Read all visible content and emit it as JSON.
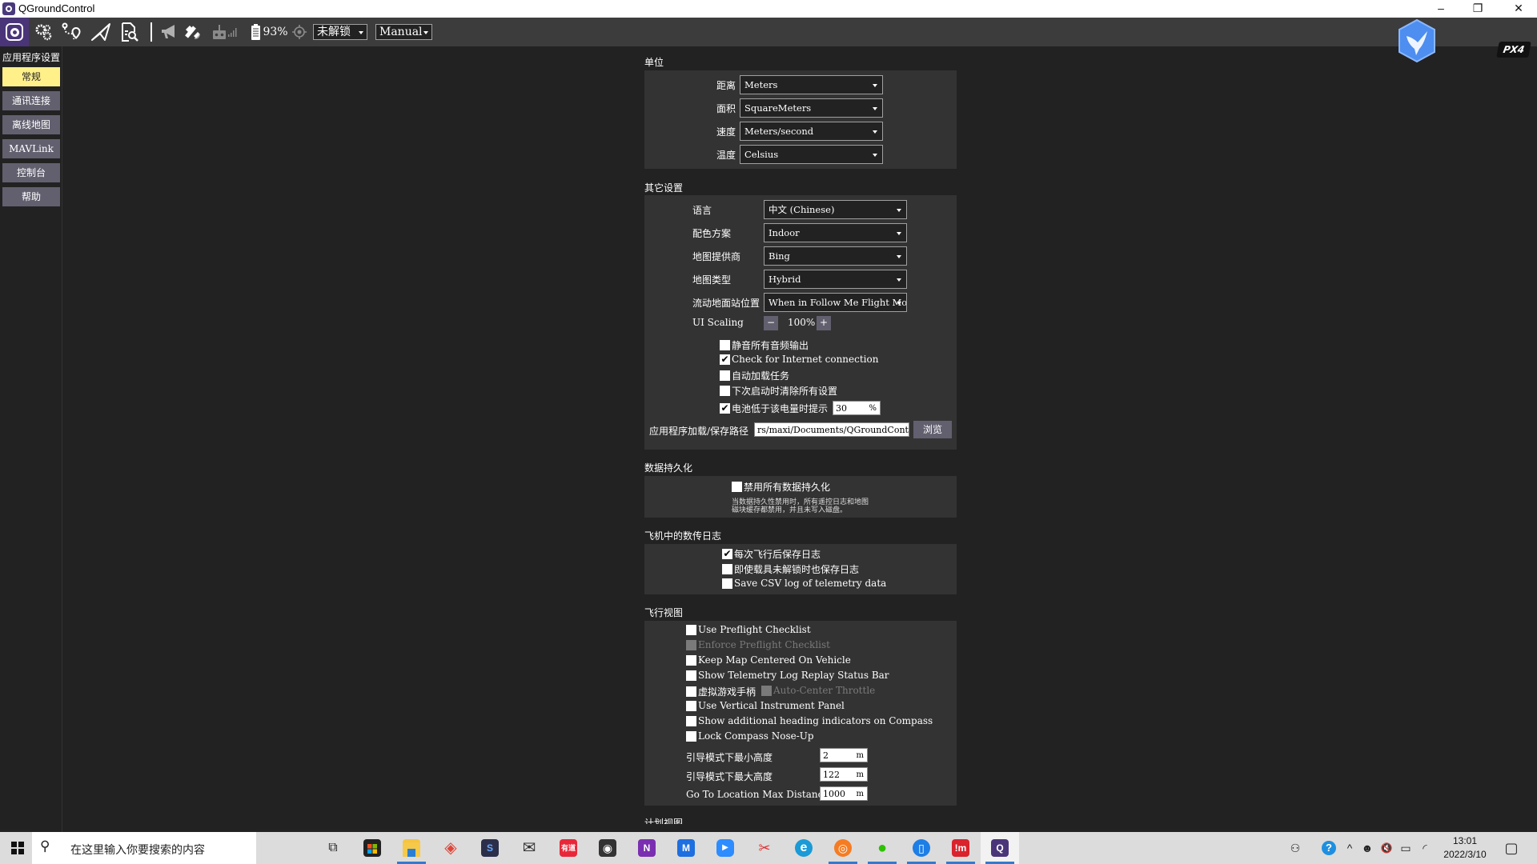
{
  "window": {
    "title": "QGroundControl",
    "controls": {
      "minimize": "–",
      "restore": "❐",
      "close": "✕"
    }
  },
  "toolbar": {
    "icons": [
      "qgc-logo-icon",
      "settings-gears-icon",
      "plan-route-icon",
      "fly-paper-plane-icon",
      "analyze-document-icon",
      "messages-megaphone-icon",
      "gps-satellite-icon",
      "rc-transmitter-icon",
      "rc-signal-icon",
      "battery-icon",
      "mode-target-icon"
    ],
    "battery_label": "93%",
    "arm_status": "未解锁",
    "flight_mode": "Manual",
    "brand_badge": "bird-hexagon-icon",
    "px4_logo": "PX4"
  },
  "sidebar": {
    "header": "应用程序设置",
    "items": [
      {
        "label": "常规",
        "active": true
      },
      {
        "label": "通讯连接",
        "active": false
      },
      {
        "label": "离线地图",
        "active": false
      },
      {
        "label": "MAVLink",
        "active": false
      },
      {
        "label": "控制台",
        "active": false
      },
      {
        "label": "帮助",
        "active": false
      }
    ]
  },
  "units": {
    "title": "单位",
    "rows": [
      {
        "label": "距离",
        "value": "Meters"
      },
      {
        "label": "面积",
        "value": "SquareMeters"
      },
      {
        "label": "速度",
        "value": "Meters/second"
      },
      {
        "label": "温度",
        "value": "Celsius"
      }
    ]
  },
  "misc": {
    "title": "其它设置",
    "rows": [
      {
        "label": "语言",
        "value": "中文 (Chinese)"
      },
      {
        "label": "配色方案",
        "value": "Indoor"
      },
      {
        "label": "地图提供商",
        "value": "Bing"
      },
      {
        "label": "地图类型",
        "value": "Hybrid"
      },
      {
        "label": "流动地面站位置",
        "value": "When in Follow Me Flight Mode"
      }
    ],
    "ui_scaling": {
      "label": "UI Scaling",
      "minus": "−",
      "value": "100%",
      "plus": "+"
    },
    "checks": [
      {
        "label": "静音所有音频输出",
        "checked": false
      },
      {
        "label": "Check for Internet connection",
        "checked": true
      },
      {
        "label": "自动加载任务",
        "checked": false
      },
      {
        "label": "下次启动时清除所有设置",
        "checked": false
      },
      {
        "label": "电池低于该电量时提示",
        "checked": true
      }
    ],
    "battery_threshold": {
      "value": "30",
      "unit": "%"
    },
    "save_path": {
      "label": "应用程序加载/保存路径",
      "value": "rs/maxi/Documents/QGroundControl",
      "browse": "浏览"
    }
  },
  "persistence": {
    "title": "数据持久化",
    "check": {
      "label": "禁用所有数据持久化",
      "checked": false
    },
    "note_line1": "当数据持久性禁用时，所有遥控日志和地图",
    "note_line2": "磁块缓存都禁用，并且未写入磁盘。"
  },
  "telemetry_log": {
    "title": "飞机中的数传日志",
    "checks": [
      {
        "label": "每次飞行后保存日志",
        "checked": true
      },
      {
        "label": "即使载具未解锁时也保存日志",
        "checked": false
      },
      {
        "label": "Save CSV log of telemetry data",
        "checked": false
      }
    ]
  },
  "fly_view": {
    "title": "飞行视图",
    "checks": [
      {
        "label": "Use Preflight Checklist",
        "checked": false,
        "disabled": false
      },
      {
        "label": "Enforce Preflight Checklist",
        "checked": false,
        "disabled": true
      },
      {
        "label": "Keep Map Centered On Vehicle",
        "checked": false,
        "disabled": false
      },
      {
        "label": "Show Telemetry Log Replay Status Bar",
        "checked": false,
        "disabled": false
      },
      {
        "label": "虚拟游戏手柄",
        "checked": false,
        "disabled": false
      },
      {
        "label": "Use Vertical Instrument Panel",
        "checked": false,
        "disabled": false
      },
      {
        "label": "Show additional heading indicators on Compass",
        "checked": false,
        "disabled": false
      },
      {
        "label": "Lock Compass Nose-Up",
        "checked": false,
        "disabled": false
      }
    ],
    "auto_center_throttle": {
      "label": "Auto-Center Throttle",
      "checked": false,
      "disabled": true
    },
    "fields": [
      {
        "label": "引导模式下最小高度",
        "value": "2",
        "unit": "m"
      },
      {
        "label": "引导模式下最大高度",
        "value": "122",
        "unit": "m"
      },
      {
        "label": "Go To Location Max Distance",
        "value": "1000",
        "unit": "m"
      }
    ]
  },
  "plan_view": {
    "title": "计划视图"
  },
  "taskbar": {
    "search_placeholder": "在这里输入你要搜索的内容",
    "apps": [
      {
        "name": "task-view",
        "glyph": "⧉"
      },
      {
        "name": "microsoft-store",
        "glyph": "▦"
      },
      {
        "name": "file-explorer",
        "glyph": "▬"
      },
      {
        "name": "app-red-diamond",
        "glyph": "◈"
      },
      {
        "name": "app-dark-s",
        "glyph": "S"
      },
      {
        "name": "mail",
        "glyph": "✉"
      },
      {
        "name": "youdao",
        "glyph": "有道"
      },
      {
        "name": "camera",
        "glyph": "◉"
      },
      {
        "name": "onenote",
        "glyph": "N"
      },
      {
        "name": "app-blue-m",
        "glyph": "M"
      },
      {
        "name": "zoom",
        "glyph": "▶"
      },
      {
        "name": "snipping-tool",
        "glyph": "✂"
      },
      {
        "name": "edge",
        "glyph": "e"
      },
      {
        "name": "firefox",
        "glyph": "◎"
      },
      {
        "name": "wechat",
        "glyph": "●"
      },
      {
        "name": "phone-link",
        "glyph": "▯"
      },
      {
        "name": "app-red-im",
        "glyph": "!m"
      },
      {
        "name": "qgroundcontrol",
        "glyph": "Q"
      }
    ],
    "tray": {
      "people": "⚇",
      "help": "?",
      "chevron": "^",
      "qq": "☻",
      "volume": "🔇",
      "battery": "▭",
      "wifi": "◜"
    },
    "time": "13:01",
    "date": "2022/3/10",
    "notifications": "▢"
  }
}
